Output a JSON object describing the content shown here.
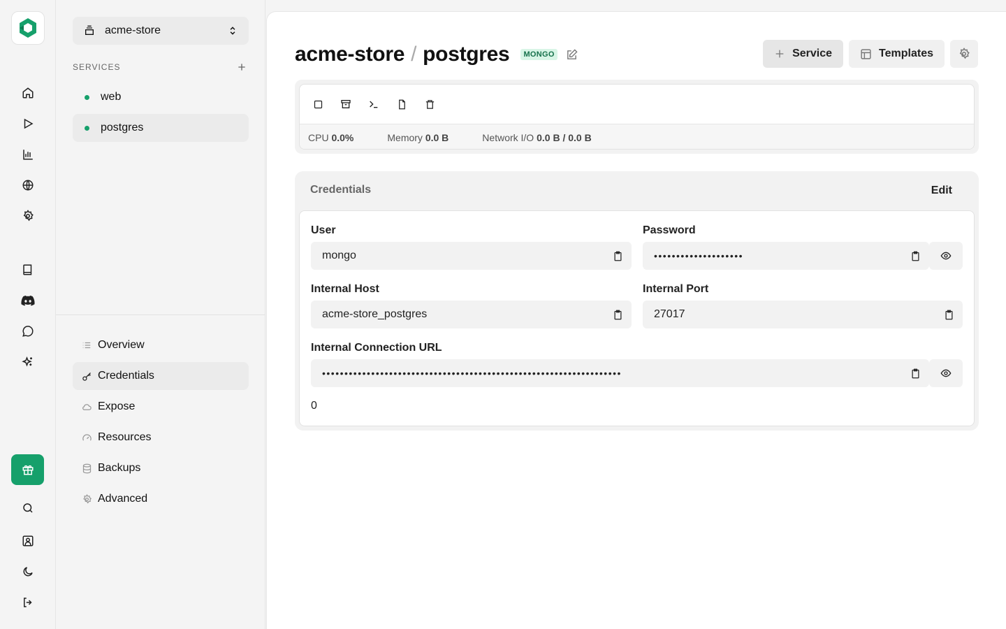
{
  "rail": {
    "nav_icons": [
      "home-icon",
      "play-icon",
      "bar-chart-icon",
      "globe-icon",
      "gear-icon"
    ],
    "link_icons": [
      "book-icon",
      "discord-icon",
      "chat-icon",
      "sparkles-icon"
    ],
    "bottom_icons": [
      "search-icon",
      "user-icon",
      "moon-icon",
      "logout-icon"
    ],
    "accent": "#16a06b"
  },
  "sidebar": {
    "project": "acme-store",
    "services_label": "SERVICES",
    "services": [
      {
        "name": "web",
        "active": false
      },
      {
        "name": "postgres",
        "active": true
      }
    ],
    "menu": [
      {
        "label": "Overview",
        "icon": "list-icon"
      },
      {
        "label": "Credentials",
        "icon": "key-icon"
      },
      {
        "label": "Expose",
        "icon": "cloud-icon"
      },
      {
        "label": "Resources",
        "icon": "gauge-icon"
      },
      {
        "label": "Backups",
        "icon": "database-icon"
      },
      {
        "label": "Advanced",
        "icon": "gear-icon"
      }
    ]
  },
  "header": {
    "project": "acme-store",
    "separator": "/",
    "service": "postgres",
    "badge": "MONGO",
    "service_button": "Service",
    "templates_button": "Templates"
  },
  "status": {
    "cpu_label": "CPU",
    "cpu_value": "0.0%",
    "memory_label": "Memory",
    "memory_value": "0.0 B",
    "network_label": "Network I/O",
    "network_value": "0.0 B / 0.0 B"
  },
  "credentials": {
    "title": "Credentials",
    "edit_label": "Edit",
    "user_label": "User",
    "user_value": "mongo",
    "password_label": "Password",
    "password_value": "••••••••••••••••••••",
    "host_label": "Internal Host",
    "host_value": "acme-store_postgres",
    "port_label": "Internal Port",
    "port_value": "27017",
    "url_label": "Internal Connection URL",
    "url_value": "•••••••••••••••••••••••••••••••••••••••••••••••••••••••••••••••••••",
    "footer_value": "0"
  }
}
